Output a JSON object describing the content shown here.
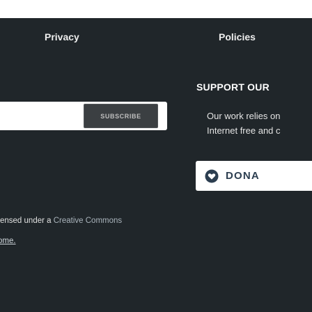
{
  "footer": {
    "columns": {
      "privacy": "Privacy",
      "policies": "Policies"
    },
    "newsletter": {
      "subscribe_label": "SUBSCRIBE"
    },
    "support": {
      "title": "SUPPORT OUR",
      "line1": "Our work relies on",
      "line2": "Internet free and c"
    },
    "donate": {
      "label": "DONA",
      "icon": "heart-icon"
    },
    "license": {
      "prefix": "ensed under a ",
      "link": "Creative Commons"
    },
    "fragment": "ome."
  },
  "colors": {
    "footer_bg": "#20262a",
    "button_bg": "#3b3f42",
    "donate_text": "#2c3e50"
  }
}
